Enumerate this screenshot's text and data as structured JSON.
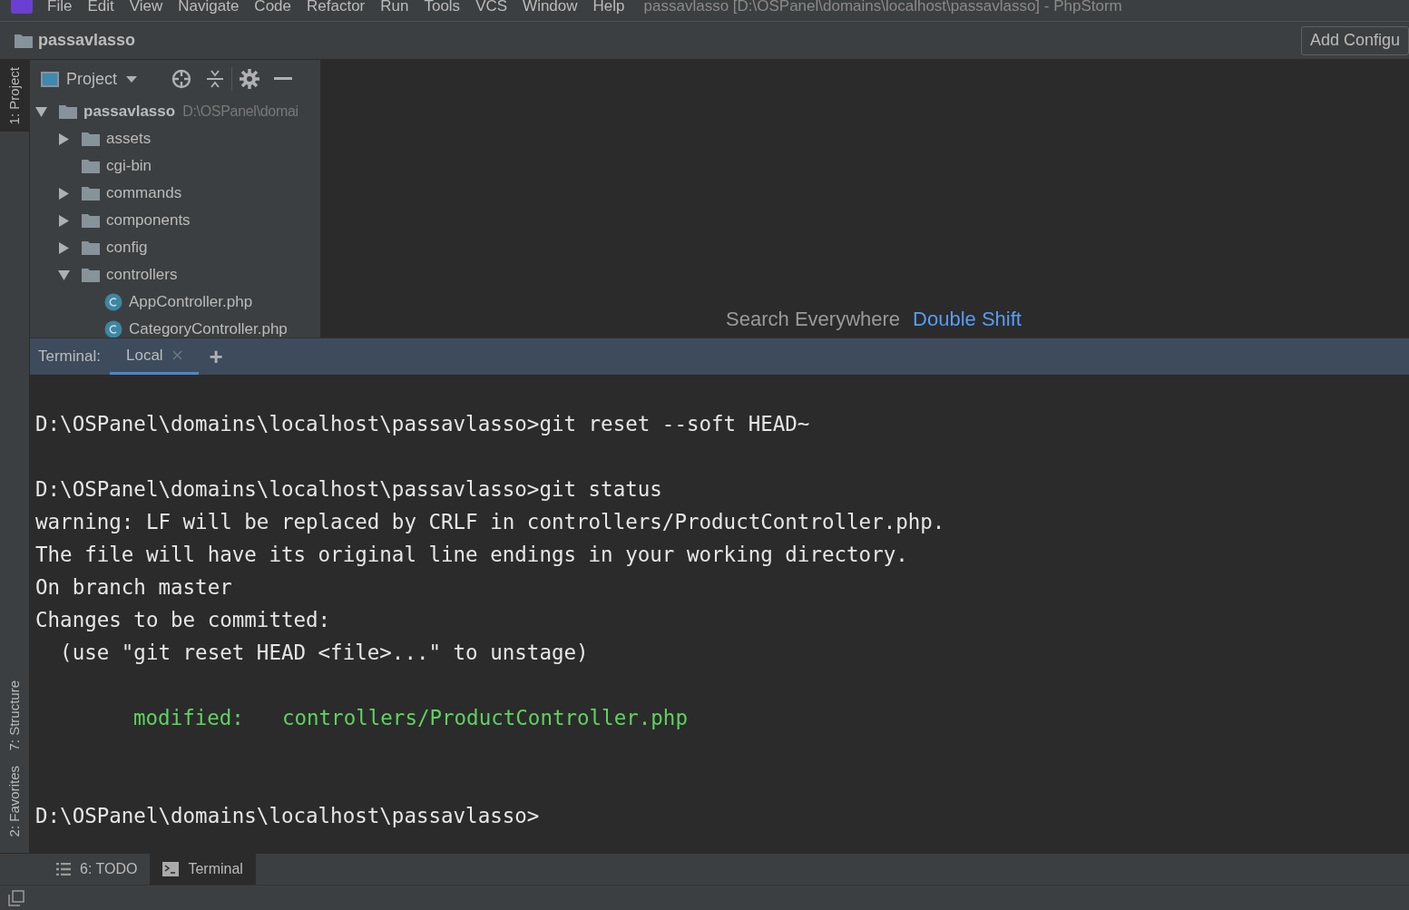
{
  "menu_bar": {
    "items": [
      "File",
      "Edit",
      "View",
      "Navigate",
      "Code",
      "Refactor",
      "Run",
      "Tools",
      "VCS",
      "Window",
      "Help"
    ],
    "window_title": "passavlasso [D:\\OSPanel\\domains\\localhost\\passavlasso] - PhpStorm"
  },
  "nav_bar": {
    "breadcrumb": "passavlasso",
    "run_config_button": "Add Configu"
  },
  "left_stripe": {
    "top": [
      {
        "label": "1: Project",
        "selected": true
      }
    ],
    "bottom": [
      {
        "label": "7: Structure",
        "selected": false
      },
      {
        "label": "2: Favorites",
        "selected": false
      }
    ]
  },
  "project_panel": {
    "view_selector": "Project",
    "tree": [
      {
        "name": "passavlasso",
        "path": "D:\\OSPanel\\domai",
        "kind": "root",
        "expanded": true,
        "children": [
          {
            "name": "assets",
            "kind": "folder",
            "expanded": false
          },
          {
            "name": "cgi-bin",
            "kind": "leaf-folder"
          },
          {
            "name": "commands",
            "kind": "folder",
            "expanded": false
          },
          {
            "name": "components",
            "kind": "folder",
            "expanded": false
          },
          {
            "name": "config",
            "kind": "folder",
            "expanded": false
          },
          {
            "name": "controllers",
            "kind": "folder",
            "expanded": true,
            "children": [
              {
                "name": "AppController.php",
                "kind": "class-file"
              },
              {
                "name": "CategoryController.php",
                "kind": "class-file"
              }
            ]
          }
        ]
      }
    ]
  },
  "editor": {
    "hint": "Search Everywhere",
    "shortcut": "Double Shift"
  },
  "terminal": {
    "label": "Terminal:",
    "tabs": [
      {
        "label": "Local",
        "selected": true
      }
    ],
    "add_button": "+",
    "lines": [
      {
        "kind": "blank"
      },
      {
        "kind": "text",
        "text": "D:\\OSPanel\\domains\\localhost\\passavlasso>git reset --soft HEAD~"
      },
      {
        "kind": "blank"
      },
      {
        "kind": "text",
        "text": "D:\\OSPanel\\domains\\localhost\\passavlasso>git status"
      },
      {
        "kind": "text",
        "text": "warning: LF will be replaced by CRLF in controllers/ProductController.php."
      },
      {
        "kind": "text",
        "text": "The file will have its original line endings in your working directory."
      },
      {
        "kind": "text",
        "text": "On branch master"
      },
      {
        "kind": "text",
        "text": "Changes to be committed:"
      },
      {
        "kind": "text",
        "text": "  (use \"git reset HEAD <file>...\" to unstage)"
      },
      {
        "kind": "blank"
      },
      {
        "kind": "change",
        "label": "modified:",
        "path": "controllers/ProductController.php"
      },
      {
        "kind": "blank"
      },
      {
        "kind": "blank"
      },
      {
        "kind": "text",
        "text": "D:\\OSPanel\\domains\\localhost\\passavlasso>"
      }
    ]
  },
  "bottom_tool_bar": [
    {
      "label": "6: TODO",
      "kind": "todo",
      "selected": false
    },
    {
      "label": "Terminal",
      "kind": "terminal",
      "selected": true
    }
  ]
}
